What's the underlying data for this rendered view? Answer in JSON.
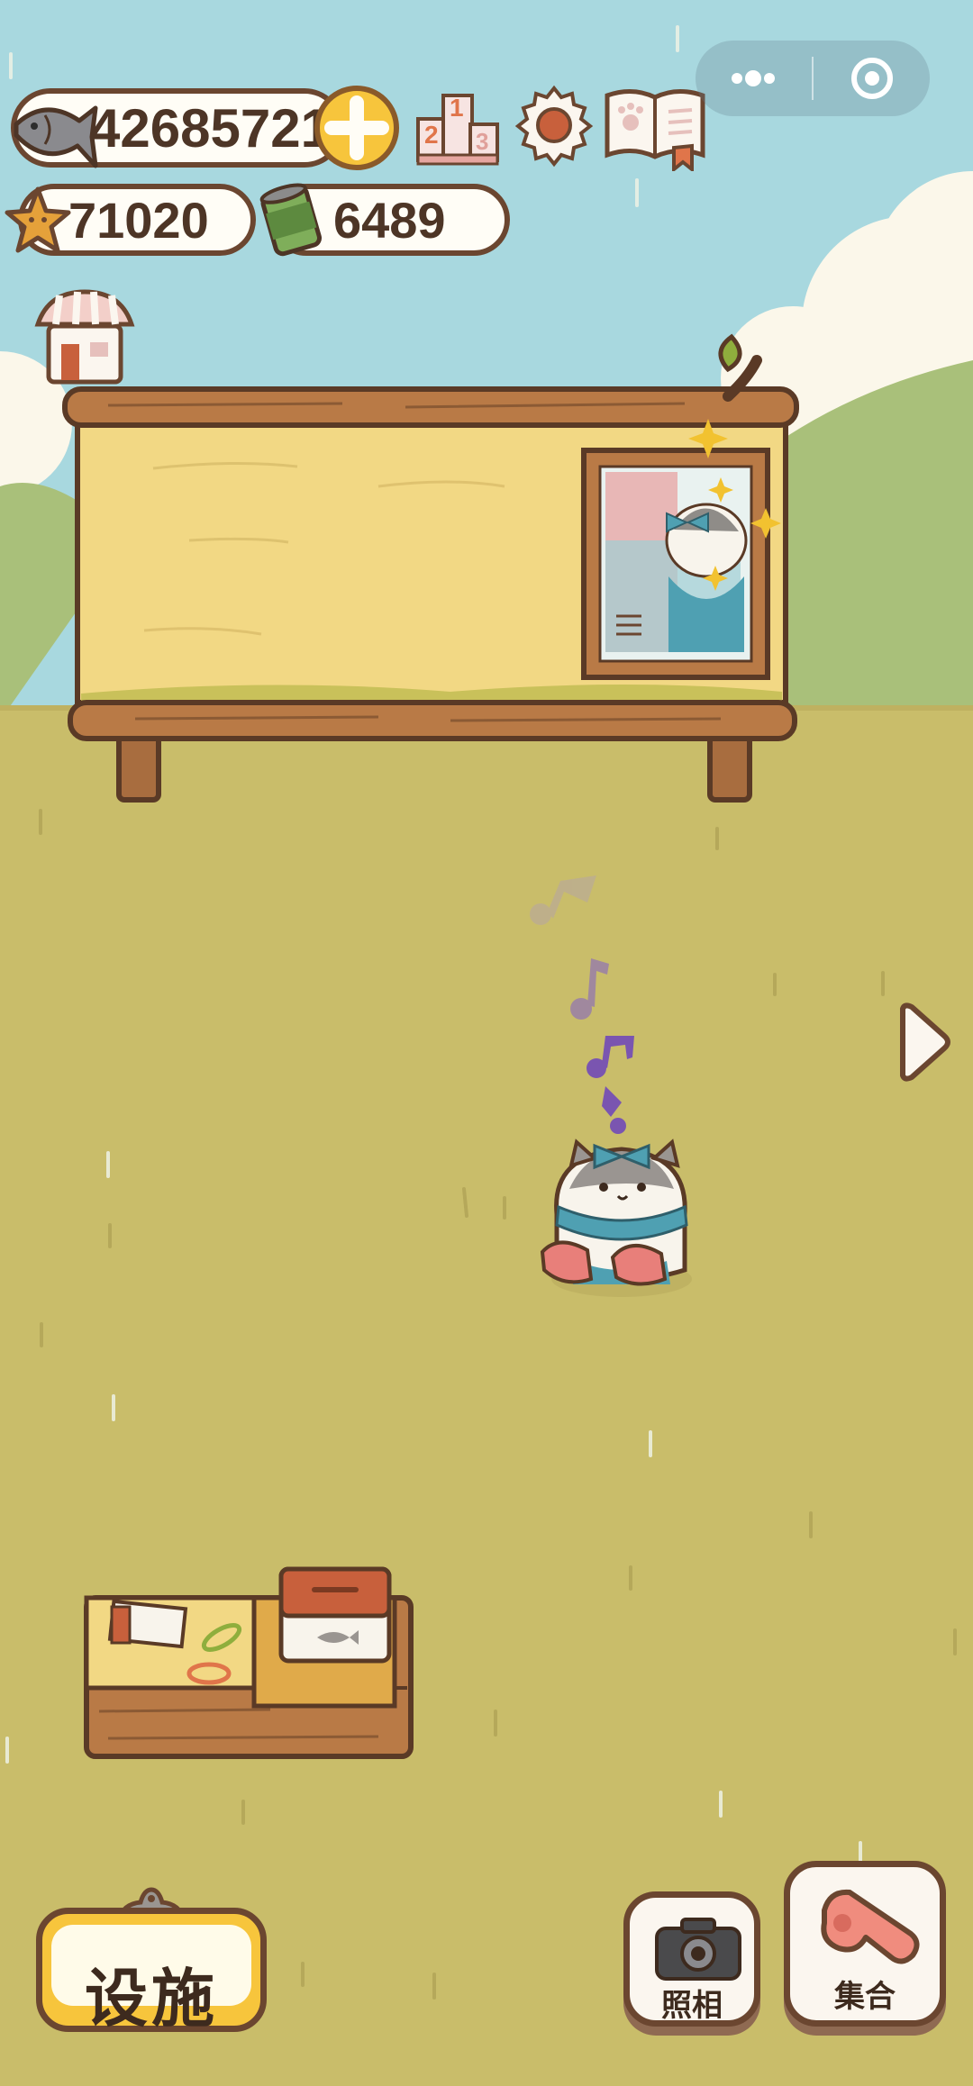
{
  "currencies": {
    "fish": {
      "value": "42685721",
      "icon": "fish-icon"
    },
    "stars": {
      "value": "71020",
      "icon": "star-cookie-icon"
    },
    "cans": {
      "value": "6489",
      "icon": "can-icon"
    }
  },
  "toolbar": {
    "add_icon": "plus-icon",
    "ranking_icon": "podium-icon",
    "settings_icon": "gear-icon",
    "album_icon": "book-icon"
  },
  "ranking_digits": {
    "first": "1",
    "second": "2",
    "third": "3"
  },
  "capsule": {
    "menu_icon": "more-dots-icon",
    "close_icon": "target-circle-icon"
  },
  "buttons": {
    "facility_label": "设施",
    "photo_label": "照相",
    "gather_label": "集合"
  },
  "colors": {
    "sky": "#a8d8df",
    "grass": "#c9bd6a",
    "outline": "#6b4630",
    "accent_yellow": "#f7c53c"
  }
}
